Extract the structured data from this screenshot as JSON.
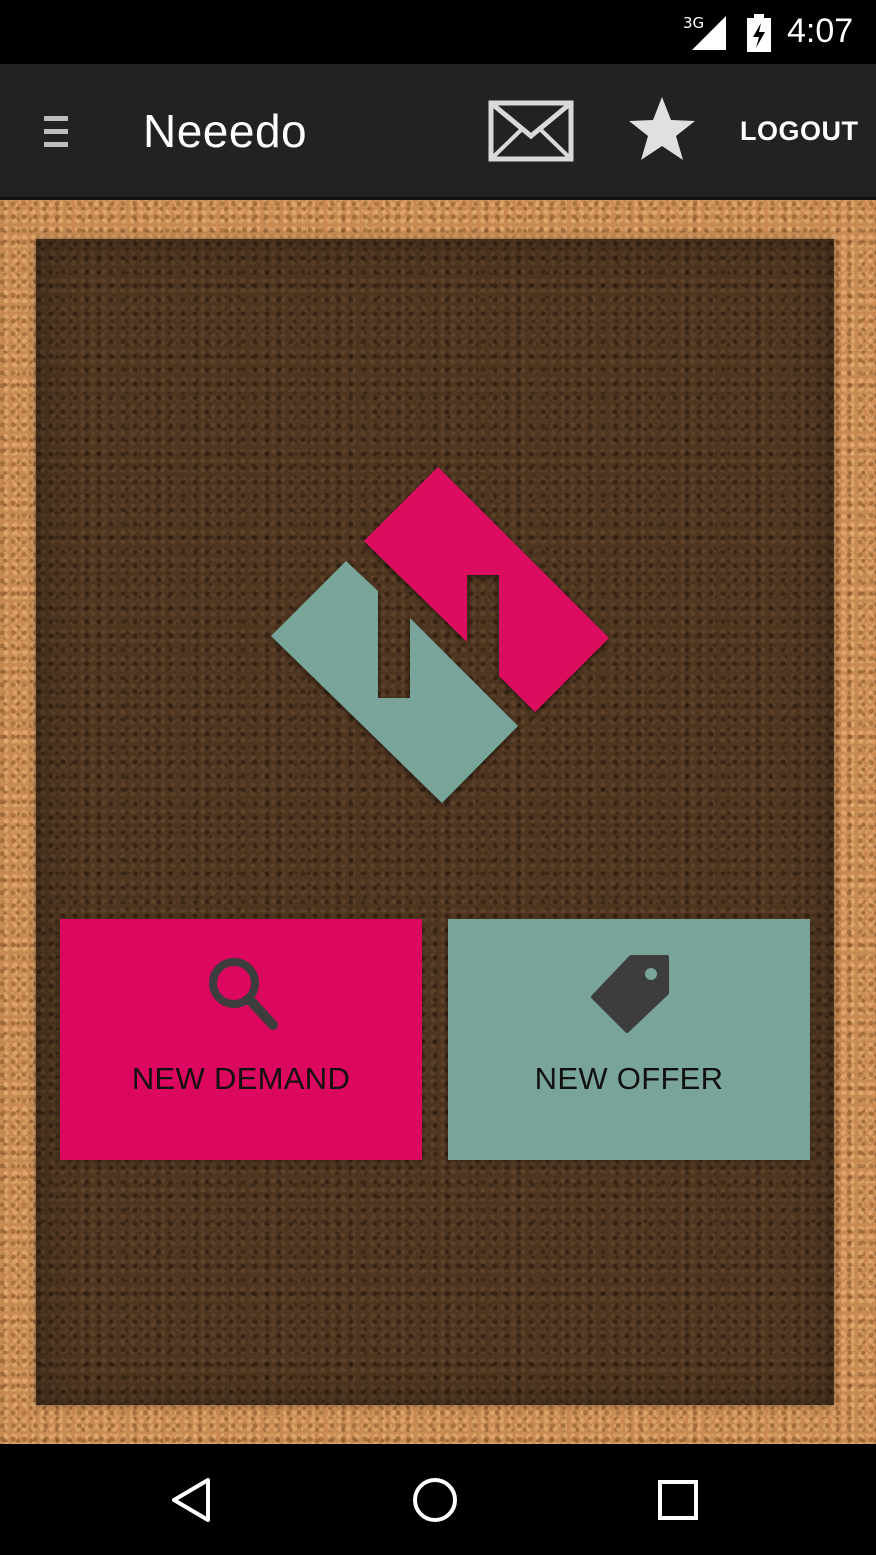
{
  "status_bar": {
    "network": "3G",
    "time": "4:07"
  },
  "action_bar": {
    "title": "Neeedo",
    "menu_icon": "hamburger-menu-icon",
    "messages_icon": "envelope-icon",
    "favorites_icon": "star-icon",
    "logout_label": "LOGOUT"
  },
  "main": {
    "logo_icon": "neeedo-logo",
    "tiles": [
      {
        "label": "NEW DEMAND",
        "icon": "search-icon",
        "color": "#dc085f"
      },
      {
        "label": "NEW OFFER",
        "icon": "tag-icon",
        "color": "#79a499"
      }
    ]
  },
  "nav_bar": {
    "back_icon": "back-triangle-icon",
    "home_icon": "home-circle-icon",
    "recents_icon": "recents-square-icon"
  },
  "colors": {
    "accent_pink": "#dc085f",
    "accent_teal": "#79a499",
    "action_bar": "#222222",
    "board": "#4e3520",
    "cork": "#c88a52"
  }
}
